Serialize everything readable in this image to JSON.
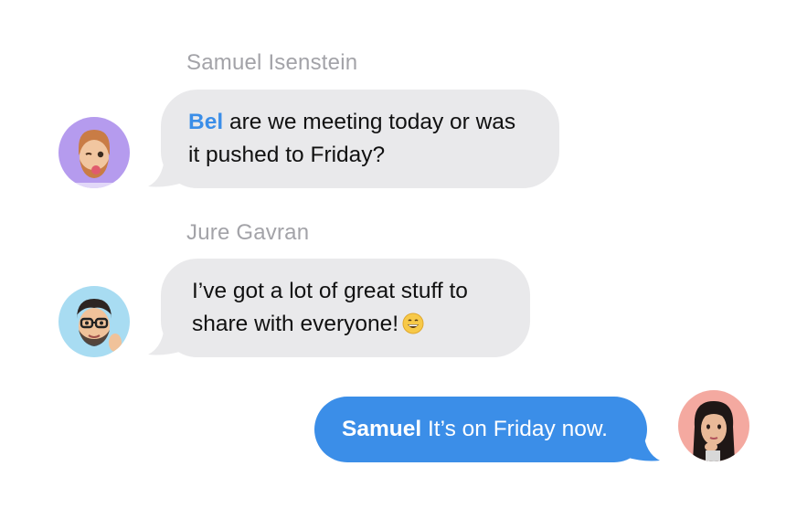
{
  "colors": {
    "background": "#ffffff",
    "received_bubble": "#e9e9eb",
    "sent_bubble": "#3b8ee8",
    "mention": "#3b8ee8",
    "sender_name": "#a3a3a8"
  },
  "messages": [
    {
      "direction": "received",
      "sender_name": "Samuel Isenstein",
      "avatar_icon": "memoji-samuel-avatar",
      "mention": "Bel",
      "text_line1": " are we meeting today or was",
      "text_line2": "it pushed to Friday?"
    },
    {
      "direction": "received",
      "sender_name": "Jure Gavran",
      "avatar_icon": "memoji-jure-avatar",
      "text_line1": "I’ve got a lot of great stuff to",
      "text_line2": "share with everyone!",
      "emoji_icon": "grinning-face-icon"
    },
    {
      "direction": "sent",
      "avatar_icon": "memoji-bel-avatar",
      "mention": "Samuel",
      "text": " It’s on Friday now."
    }
  ]
}
